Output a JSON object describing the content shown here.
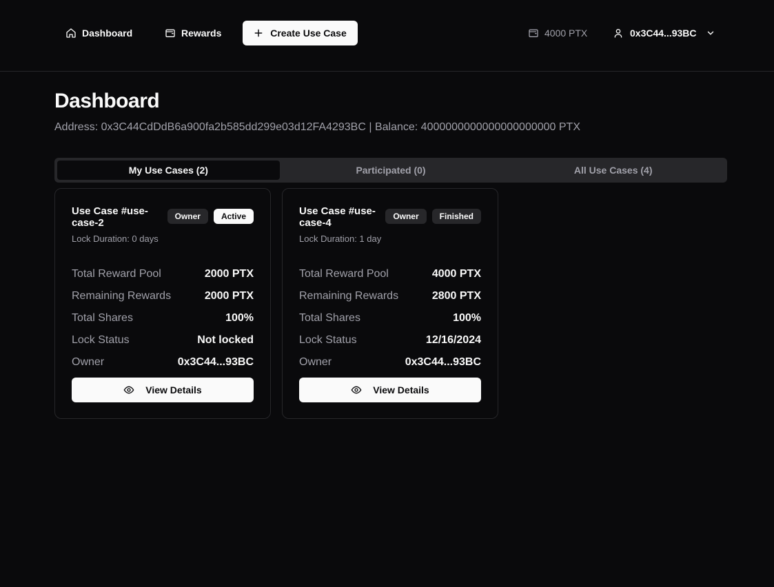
{
  "nav": {
    "dashboard_label": "Dashboard",
    "rewards_label": "Rewards",
    "create_label": "Create Use Case",
    "balance": "4000 PTX",
    "account": "0x3C44...93BC"
  },
  "icons": {
    "dashboard": "home-icon",
    "rewards": "wallet-icon",
    "create": "plus-icon",
    "balance": "wallet-icon",
    "account": "user-icon",
    "account_menu": "chevron-down-icon",
    "view_details": "eye-icon"
  },
  "page": {
    "title": "Dashboard",
    "subtitle": "Address: 0x3C44CdDdB6a900fa2b585dd299e03d12FA4293BC | Balance: 4000000000000000000000 PTX"
  },
  "tabs": [
    {
      "label": "My Use Cases (2)",
      "active": true
    },
    {
      "label": "Participated (0)",
      "active": false
    },
    {
      "label": "All Use Cases (4)",
      "active": false
    }
  ],
  "cards": [
    {
      "title": "Use Case #use-case-2",
      "badges": [
        "Owner",
        "Active"
      ],
      "lock_duration": "Lock Duration: 0 days",
      "rows": [
        {
          "key": "Total Reward Pool",
          "value": "2000 PTX"
        },
        {
          "key": "Remaining Rewards",
          "value": "2000 PTX"
        },
        {
          "key": "Total Shares",
          "value": "100%"
        },
        {
          "key": "Lock Status",
          "value": "Not locked"
        },
        {
          "key": "Owner",
          "value": "0x3C44...93BC"
        }
      ],
      "button": "View Details"
    },
    {
      "title": "Use Case #use-case-4",
      "badges": [
        "Owner",
        "Finished"
      ],
      "lock_duration": "Lock Duration: 1 day",
      "rows": [
        {
          "key": "Total Reward Pool",
          "value": "4000 PTX"
        },
        {
          "key": "Remaining Rewards",
          "value": "2800 PTX"
        },
        {
          "key": "Total Shares",
          "value": "100%"
        },
        {
          "key": "Lock Status",
          "value": "12/16/2024"
        },
        {
          "key": "Owner",
          "value": "0x3C44...93BC"
        }
      ],
      "button": "View Details"
    }
  ],
  "colors": {
    "background": "#0a0a0c",
    "border": "#27272a",
    "text": "#fafafa",
    "muted": "#a1a1aa",
    "button_light": "#fafafa"
  }
}
